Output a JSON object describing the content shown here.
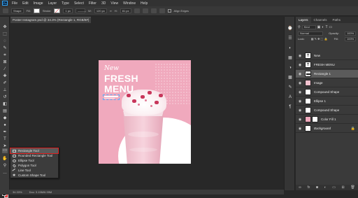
{
  "app": {
    "logo_text": "Ps",
    "menu": [
      "File",
      "Edit",
      "Image",
      "Layer",
      "Type",
      "Select",
      "Filter",
      "3D",
      "View",
      "Window",
      "Help"
    ]
  },
  "options_bar": {
    "mode": "Shape",
    "fill_label": "Fill:",
    "stroke_label": "Stroke:",
    "stroke_size": "1 px",
    "width_label": "W:",
    "width_value": "120 px",
    "height_label": "H:",
    "height_value": "81 px",
    "align_edges": "Align Edges"
  },
  "document": {
    "tab_title": "Poster Instagram.psd @ 34.3% (Rectangle 1, RGB/8#) *"
  },
  "artboard": {
    "new_text": "New",
    "fresh_text": "FRESH",
    "menu_text": "MENU"
  },
  "flyout": {
    "items": [
      {
        "label": "Rectangle Tool",
        "shortcut": "U",
        "icon": "rectangle-icon"
      },
      {
        "label": "Rounded Rectangle Tool",
        "shortcut": "U",
        "icon": "rounded-rectangle-icon"
      },
      {
        "label": "Ellipse Tool",
        "shortcut": "U",
        "icon": "ellipse-icon"
      },
      {
        "label": "Polygon Tool",
        "shortcut": "U",
        "icon": "polygon-icon"
      },
      {
        "label": "Line Tool",
        "shortcut": "U",
        "icon": "line-icon"
      },
      {
        "label": "Custom Shape Tool",
        "shortcut": "U",
        "icon": "custom-shape-icon"
      }
    ],
    "selected_index": 0
  },
  "layers_panel": {
    "tabs": [
      "Layers",
      "Channels",
      "Paths"
    ],
    "active_tab": "Layers",
    "filter_kind": "Kind",
    "blend_mode": "Normal",
    "opacity_label": "Opacity:",
    "opacity_value": "100%",
    "lock_label": "Lock:",
    "fill_label": "Fill:",
    "fill_value": "100%",
    "layers": [
      {
        "name": "New",
        "type": "text",
        "italic": false
      },
      {
        "name": "FRESH MENU",
        "type": "text",
        "italic": false
      },
      {
        "name": "Rectangle 1",
        "type": "shape",
        "italic": false,
        "selected": true
      },
      {
        "name": "Image",
        "type": "image",
        "italic": false
      },
      {
        "name": "Compound Shape",
        "type": "shape",
        "italic": false
      },
      {
        "name": "Ellipse 1",
        "type": "shape",
        "italic": false
      },
      {
        "name": "Compound Shape",
        "type": "shape",
        "italic": false
      },
      {
        "name": "Color Fill 1",
        "type": "fill",
        "italic": false
      },
      {
        "name": "Background",
        "type": "background",
        "italic": true
      }
    ]
  },
  "status": {
    "zoom": "34.33%",
    "doc_size": "Doc: 3.15M/6.99M"
  },
  "colors": {
    "artboard_pink": "#f0a9bd",
    "selection_red": "#e02020",
    "background_swatch": "#e23b3b"
  }
}
